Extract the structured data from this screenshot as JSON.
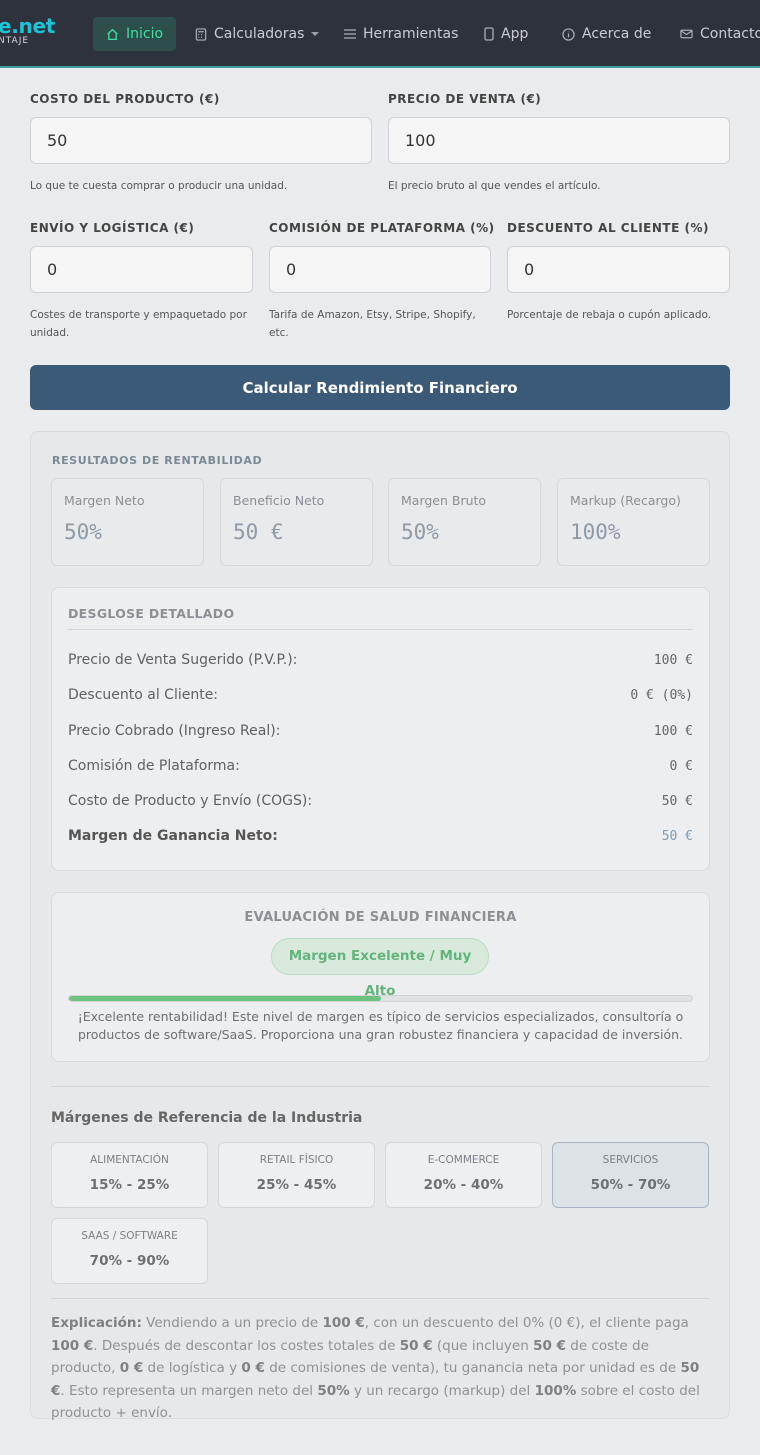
{
  "nav": {
    "brand_main": "e.net",
    "brand_sub": "NTAJE",
    "items": [
      {
        "label": "Inicio",
        "icon": "home-icon",
        "active": true
      },
      {
        "label": "Calculadoras",
        "icon": "calculator-icon"
      },
      {
        "label": "Herramientas",
        "icon": "list-icon"
      },
      {
        "label": "App",
        "icon": "phone-icon"
      },
      {
        "label": "Acerca de",
        "icon": "info-icon"
      },
      {
        "label": "Contacto",
        "icon": "mail-icon"
      }
    ],
    "accent_color": "#3fe0a0"
  },
  "form": {
    "cost": {
      "label": "Costo del producto (€)",
      "value": "50",
      "hint": "Lo que te cuesta comprar o producir una unidad."
    },
    "price": {
      "label": "Precio de venta (€)",
      "value": "100",
      "hint": "El precio bruto al que vendes el artículo."
    },
    "shipping": {
      "label": "Envío y logística (€)",
      "value": "0",
      "hint": "Costes de transporte y empaquetado por unidad."
    },
    "commission": {
      "label": "Comisión de plataforma (%)",
      "value": "0",
      "hint": "Tarifa de Amazon, Etsy, Stripe, Shopify, etc."
    },
    "discount": {
      "label": "Descuento al cliente (%)",
      "value": "0",
      "hint": "Porcentaje de rebaja o cupón aplicado."
    },
    "submit_label": "Calcular Rendimiento Financiero"
  },
  "results": {
    "title": "RESULTADOS DE RENTABILIDAD",
    "kpis": [
      {
        "label": "Margen Neto",
        "value": "50%"
      },
      {
        "label": "Beneficio Neto",
        "value": "50 €"
      },
      {
        "label": "Margen Bruto",
        "value": "50%"
      },
      {
        "label": "Markup (Recargo)",
        "value": "100%"
      }
    ],
    "breakdown": {
      "title": "DESGLOSE DETALLADO",
      "rows": [
        {
          "label": "Precio de Venta Sugerido (P.V.P.):",
          "value": "100 €"
        },
        {
          "label": "Descuento al Cliente:",
          "value": "0 € (0%)"
        },
        {
          "label": "Precio Cobrado (Ingreso Real):",
          "value": "100 €"
        },
        {
          "label": "Comisión de Plataforma:",
          "value": "0 €"
        },
        {
          "label": "Costo de Producto y Envío (COGS):",
          "value": "50 €"
        },
        {
          "label": "Margen de Ganancia Neto:",
          "value": "50 €"
        }
      ]
    },
    "health": {
      "title": "EVALUACIÓN DE SALUD FINANCIERA",
      "badge": "Margen Excelente / Muy Alto",
      "progress": 0.5,
      "description": "¡Excelente rentabilidad! Este nivel de margen es típico de servicios especializados, consultoría o productos de software/SaaS. Proporciona una gran robustez financiera y capacidad de inversión."
    },
    "references": {
      "title": "Márgenes de Referencia de la Industria",
      "items": [
        {
          "name": "Alimentación",
          "range": "15% - 25%"
        },
        {
          "name": "Retail Físico",
          "range": "25% - 45%"
        },
        {
          "name": "E-commerce",
          "range": "20% - 40%"
        },
        {
          "name": "Servicios",
          "range": "50% - 70%",
          "highlight": true
        },
        {
          "name": "SaaS / Software",
          "range": "70% - 90%"
        }
      ]
    },
    "explanation": {
      "lead": "Explicación:",
      "t1": " Vendiendo a un precio de ",
      "v1": "100 €",
      "t2": ", con un descuento del 0% (0 €), el cliente paga ",
      "v2": "100 €",
      "t3": ". Después de descontar los costes totales de ",
      "v3": "50 €",
      "t4": " (que incluyen ",
      "v4": "50 €",
      "t5": " de coste de producto, ",
      "v5": "0 €",
      "t6": " de logística y ",
      "v6": "0 €",
      "t7": " de comisiones de venta), tu ganancia neta por unidad es de ",
      "v7": "50 €",
      "t8": ". Esto representa un margen neto del ",
      "v8": "50%",
      "t9": " y un recargo (markup) del ",
      "v9": "100%",
      "t10": " sobre el costo del producto + envío."
    }
  }
}
